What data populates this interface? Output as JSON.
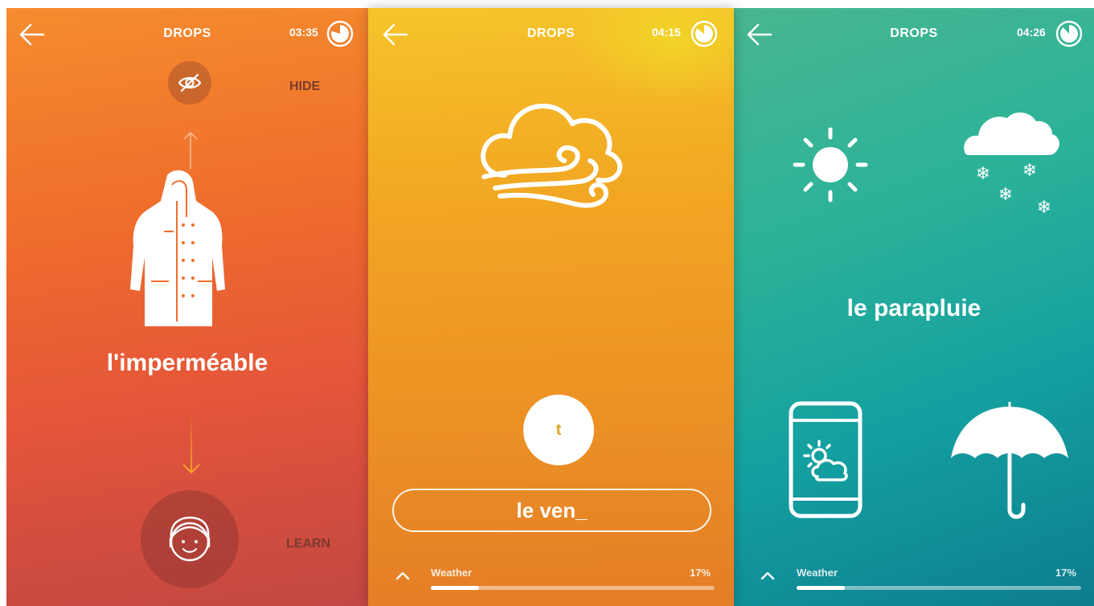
{
  "panels": [
    {
      "title": "DROPS",
      "timer": "03:35",
      "timer_fraction": 0.8,
      "hide_label": "HIDE",
      "word": "l'imperméable",
      "learn_label": "LEARN",
      "icons": [
        "back-arrow-icon",
        "eye-off-icon",
        "arrow-up-icon",
        "raincoat-icon",
        "arrow-down-icon",
        "face-icon",
        "timer-icon"
      ]
    },
    {
      "title": "DROPS",
      "timer": "04:15",
      "timer_fraction": 0.85,
      "letter_option": "t",
      "answer": "le ven_",
      "progress_label": "Weather",
      "progress_percent": "17%",
      "progress_value": 0.17,
      "icons": [
        "back-arrow-icon",
        "wind-cloud-icon",
        "chevron-up-icon",
        "timer-icon"
      ]
    },
    {
      "title": "DROPS",
      "timer": "04:26",
      "timer_fraction": 0.88,
      "word": "le parapluie",
      "progress_label": "Weather",
      "progress_percent": "17%",
      "progress_value": 0.17,
      "icons": [
        "back-arrow-icon",
        "sun-icon",
        "snow-cloud-icon",
        "phone-weather-icon",
        "umbrella-icon",
        "chevron-up-icon",
        "timer-icon"
      ]
    }
  ],
  "colors": {
    "panel1": "#ef6d2c",
    "panel2": "#f2a823",
    "panel3": "#14a0a0",
    "text": "#ffffff",
    "side_label": "#7a3a2d",
    "letter": "#e0a52a"
  }
}
